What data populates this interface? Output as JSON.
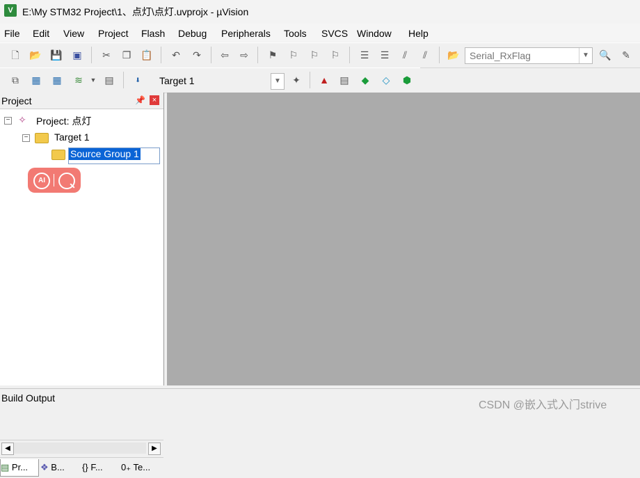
{
  "window": {
    "title": "E:\\My STM32 Project\\1、点灯\\点灯.uvprojx - µVision",
    "icon": "uvision-icon"
  },
  "menu": [
    "File",
    "Edit",
    "View",
    "Project",
    "Flash",
    "Debug",
    "Peripherals",
    "Tools",
    "SVCS",
    "Window",
    "Help"
  ],
  "toolbar": {
    "find_combo_value": "Serial_RxFlag"
  },
  "build_toolbar": {
    "target_combo_value": "Target 1"
  },
  "project_panel": {
    "title": "Project",
    "tree": {
      "project_label": "Project: 点灯",
      "target_label": "Target 1",
      "group_label": "Source Group 1"
    },
    "tabs": [
      "Pr...",
      "B...",
      "F...",
      "Te..."
    ]
  },
  "ai_widget": {
    "left": "AI",
    "right": "search"
  },
  "build_output": {
    "title": "Build Output"
  },
  "watermark": "CSDN @嵌入式入门strive"
}
